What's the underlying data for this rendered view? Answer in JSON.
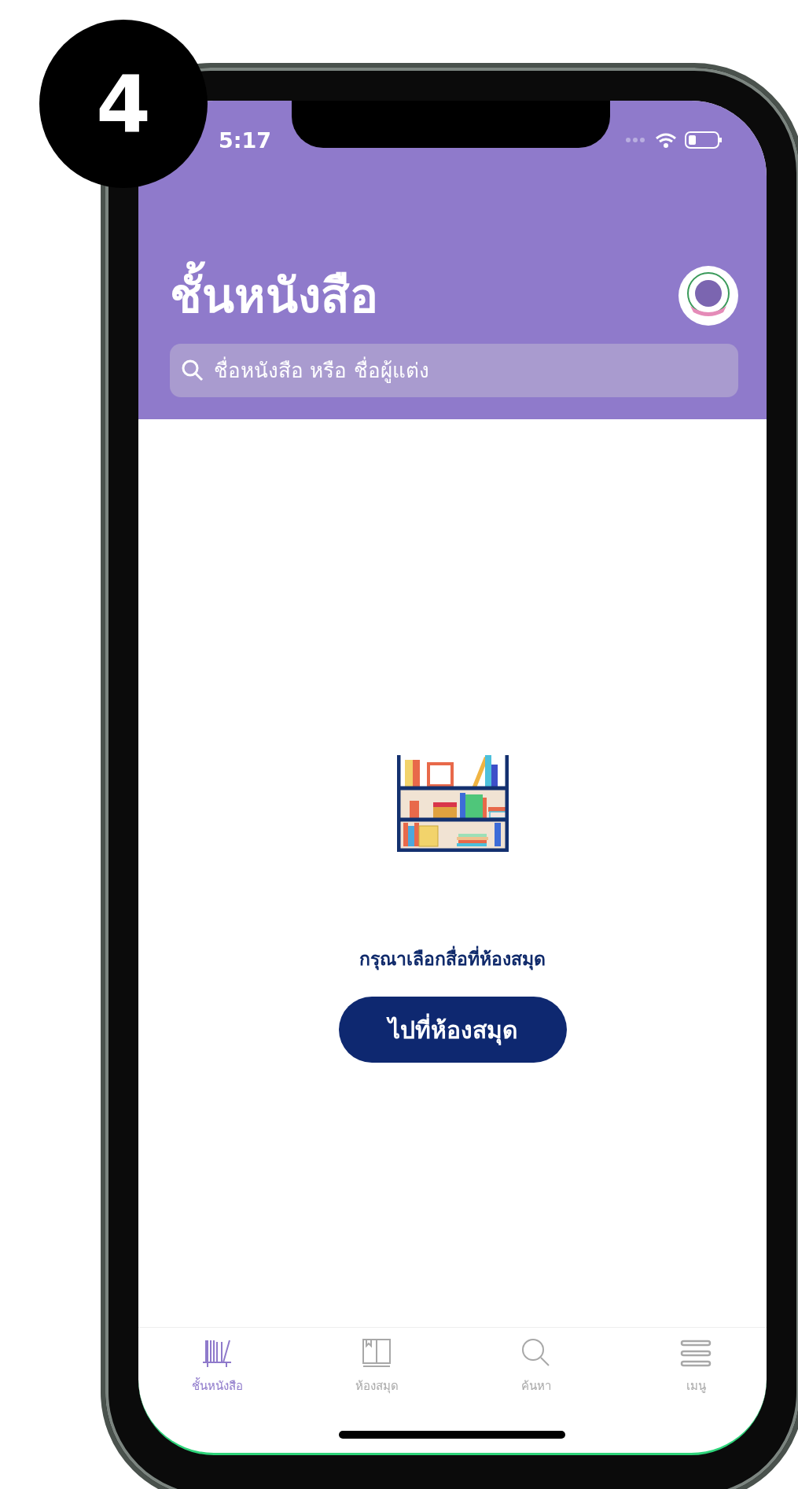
{
  "badge": {
    "number": "4"
  },
  "status_bar": {
    "time": "5:17"
  },
  "header": {
    "title": "ชั้นหนังสือ"
  },
  "search": {
    "placeholder": "ชื่อหนังสือ หรือ ชื่อผู้แต่ง"
  },
  "empty_state": {
    "message": "กรุณาเลือกสื่อที่ห้องสมุด",
    "button": "ไปที่ห้องสมุด"
  },
  "tab_bar": [
    {
      "kind": "shelf",
      "label": "ชั้นหนังสือ",
      "selected": true
    },
    {
      "kind": "library",
      "label": "ห้องสมุด",
      "selected": false
    },
    {
      "kind": "search",
      "label": "ค้นหา",
      "selected": false
    },
    {
      "kind": "menu",
      "label": "เมนู",
      "selected": false
    }
  ]
}
